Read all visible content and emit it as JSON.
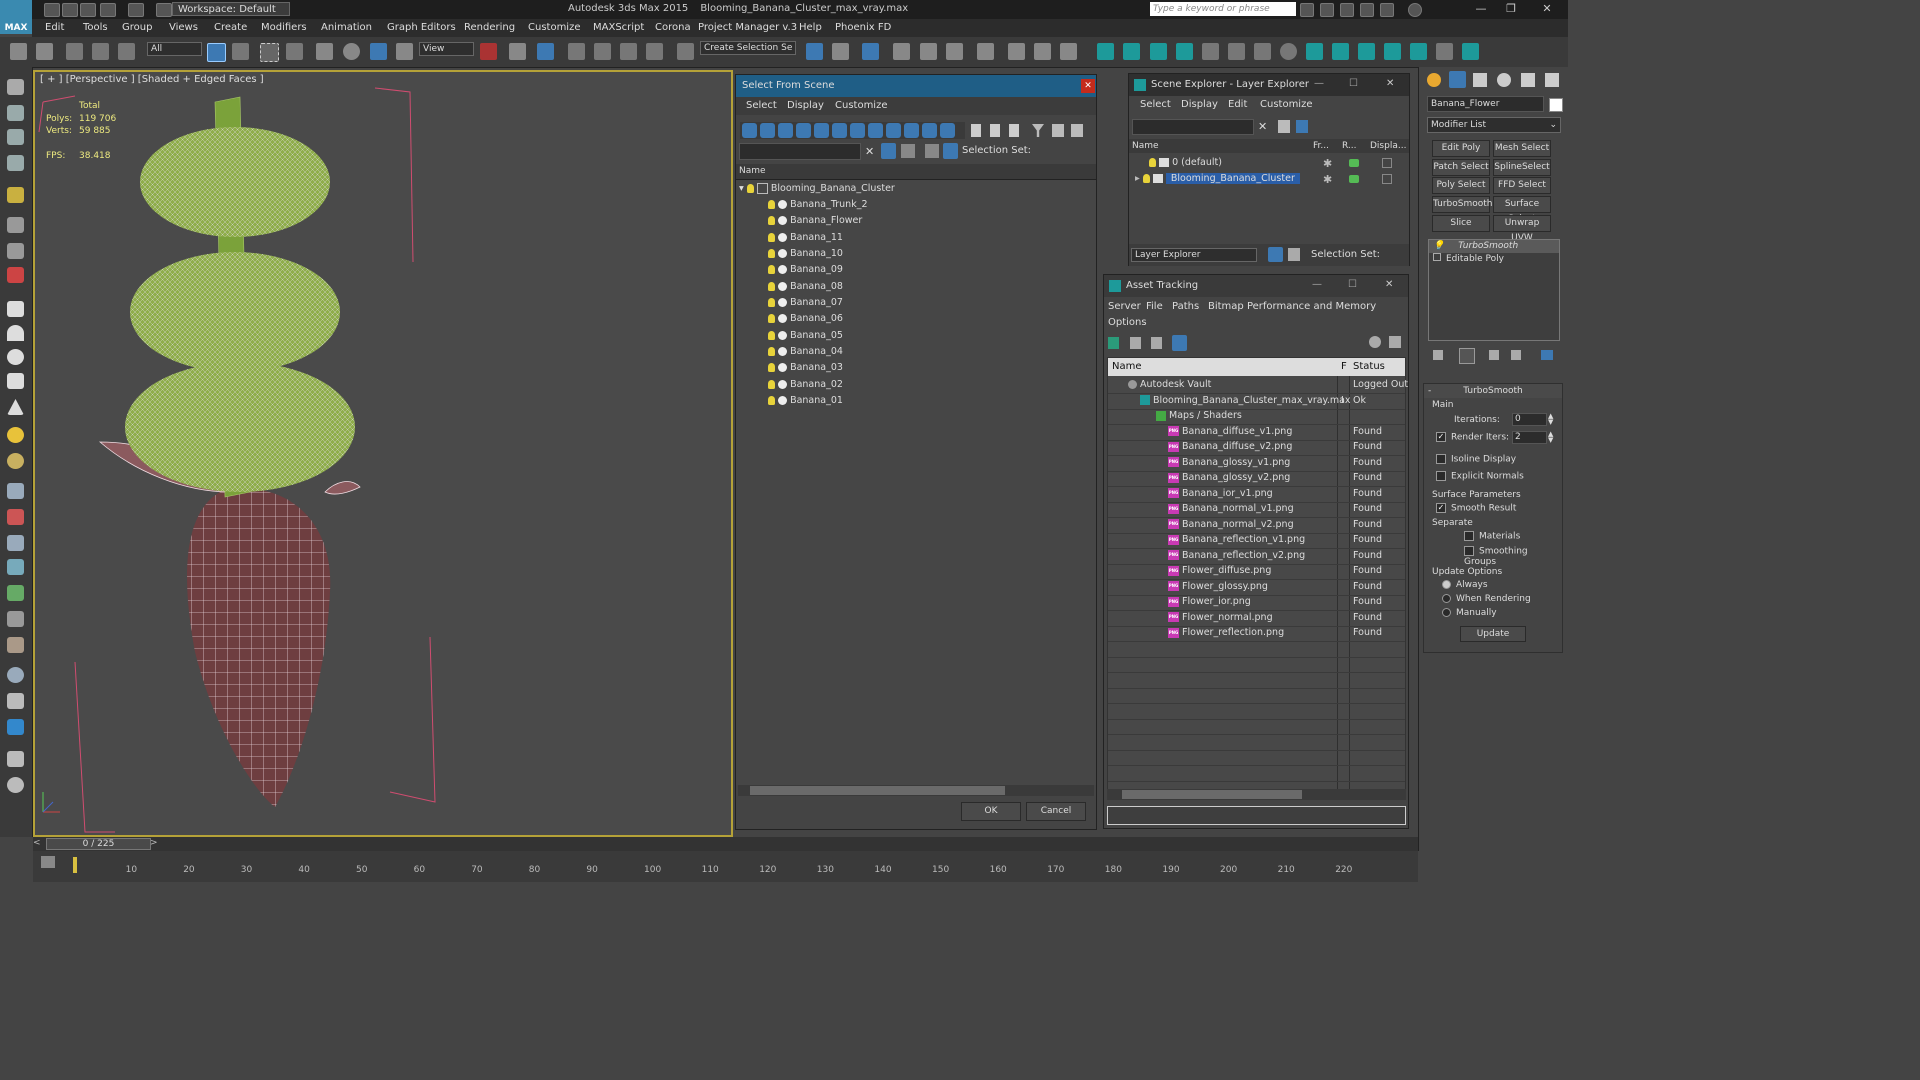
{
  "app": {
    "logo_text": "MAX",
    "workspace": "Workspace: Default",
    "product": "Autodesk 3ds Max  2015",
    "filename": "Blooming_Banana_Cluster_max_vray.max",
    "search_placeholder": "Type a keyword or phrase"
  },
  "menu": [
    "Edit",
    "Tools",
    "Group",
    "Views",
    "Create",
    "Modifiers",
    "Animation",
    "Graph Editors",
    "Rendering",
    "Customize",
    "MAXScript",
    "Corona",
    "Project Manager v.3",
    "Help",
    "Phoenix FD"
  ],
  "toolbar": {
    "selection_filter": "All",
    "ref_coord": "View",
    "named_sel": "Create Selection Se"
  },
  "viewport": {
    "label": "[ + ] [Perspective ] [Shaded + Edged Faces ]",
    "total_label": "Total",
    "polys_label": "Polys:",
    "polys": "119 706",
    "verts_label": "Verts:",
    "verts": "59 885",
    "fps_label": "FPS:",
    "fps": "38.418"
  },
  "select_dialog": {
    "title": "Select From Scene",
    "menu": [
      "Select",
      "Display",
      "Customize"
    ],
    "selection_set_label": "Selection Set:",
    "column_name": "Name",
    "root": "Blooming_Banana_Cluster",
    "items": [
      "Banana_Trunk_2",
      "Banana_Flower",
      "Banana_11",
      "Banana_10",
      "Banana_09",
      "Banana_08",
      "Banana_07",
      "Banana_06",
      "Banana_05",
      "Banana_04",
      "Banana_03",
      "Banana_02",
      "Banana_01"
    ],
    "ok": "OK",
    "cancel": "Cancel"
  },
  "scene_explorer": {
    "title": "Scene Explorer - Layer Explorer",
    "menu": [
      "Select",
      "Display",
      "Edit",
      "Customize"
    ],
    "columns": [
      "Name",
      "Fr...",
      "R...",
      "Displa..."
    ],
    "layers": [
      "0 (default)",
      "Blooming_Banana_Cluster"
    ],
    "mode": "Layer Explorer",
    "selection_set_label": "Selection Set:"
  },
  "asset_tracking": {
    "title": "Asset Tracking",
    "menu": [
      "Server",
      "File",
      "Paths",
      "Bitmap Performance and Memory"
    ],
    "menu2": "Options",
    "columns": [
      "Name",
      "F",
      "Status"
    ],
    "vault": {
      "name": "Autodesk Vault",
      "status": "Logged Out"
    },
    "file": {
      "name": "Blooming_Banana_Cluster_max_vray.max",
      "flag": "I",
      "status": "Ok"
    },
    "group": "Maps / Shaders",
    "maps": [
      {
        "name": "Banana_diffuse_v1.png",
        "status": "Found"
      },
      {
        "name": "Banana_diffuse_v2.png",
        "status": "Found"
      },
      {
        "name": "Banana_glossy_v1.png",
        "status": "Found"
      },
      {
        "name": "Banana_glossy_v2.png",
        "status": "Found"
      },
      {
        "name": "Banana_ior_v1.png",
        "status": "Found"
      },
      {
        "name": "Banana_normal_v1.png",
        "status": "Found"
      },
      {
        "name": "Banana_normal_v2.png",
        "status": "Found"
      },
      {
        "name": "Banana_reflection_v1.png",
        "status": "Found"
      },
      {
        "name": "Banana_reflection_v2.png",
        "status": "Found"
      },
      {
        "name": "Flower_diffuse.png",
        "status": "Found"
      },
      {
        "name": "Flower_glossy.png",
        "status": "Found"
      },
      {
        "name": "Flower_ior.png",
        "status": "Found"
      },
      {
        "name": "Flower_normal.png",
        "status": "Found"
      },
      {
        "name": "Flower_reflection.png",
        "status": "Found"
      }
    ],
    "png_badge": "PNG"
  },
  "command_panel": {
    "object_name": "Banana_Flower",
    "modifier_list": "Modifier List",
    "buttons": [
      "Edit Poly",
      "Mesh Select",
      "Patch Select",
      "SplineSelect",
      "Poly Select",
      "FFD Select",
      "TurboSmooth",
      "Surface Select",
      "Slice",
      "Unwrap UVW"
    ],
    "stack": [
      "TurboSmooth",
      "Editable Poly"
    ],
    "rollout": "TurboSmooth",
    "main": "Main",
    "iterations_label": "Iterations:",
    "iterations": "0",
    "render_iters_label": "Render Iters:",
    "render_iters": "2",
    "isoline": "Isoline Display",
    "explicit": "Explicit Normals",
    "surface_params": "Surface Parameters",
    "smooth_result": "Smooth Result",
    "separate": "Separate",
    "materials": "Materials",
    "smoothing_groups": "Smoothing Groups",
    "update_options": "Update Options",
    "always": "Always",
    "when_rendering": "When Rendering",
    "manually": "Manually",
    "update": "Update"
  },
  "timeline": {
    "frame": "0 / 225",
    "ticks": [
      "10",
      "20",
      "30",
      "40",
      "50",
      "60",
      "70",
      "80",
      "90",
      "100",
      "110",
      "120",
      "130",
      "140",
      "150",
      "160",
      "170",
      "180",
      "190",
      "200",
      "210",
      "220"
    ]
  },
  "colors": {
    "accent": "#1f5e86",
    "viewport_border": "#b5a238",
    "stats": "#eeea80",
    "png": "#c93ab4"
  }
}
